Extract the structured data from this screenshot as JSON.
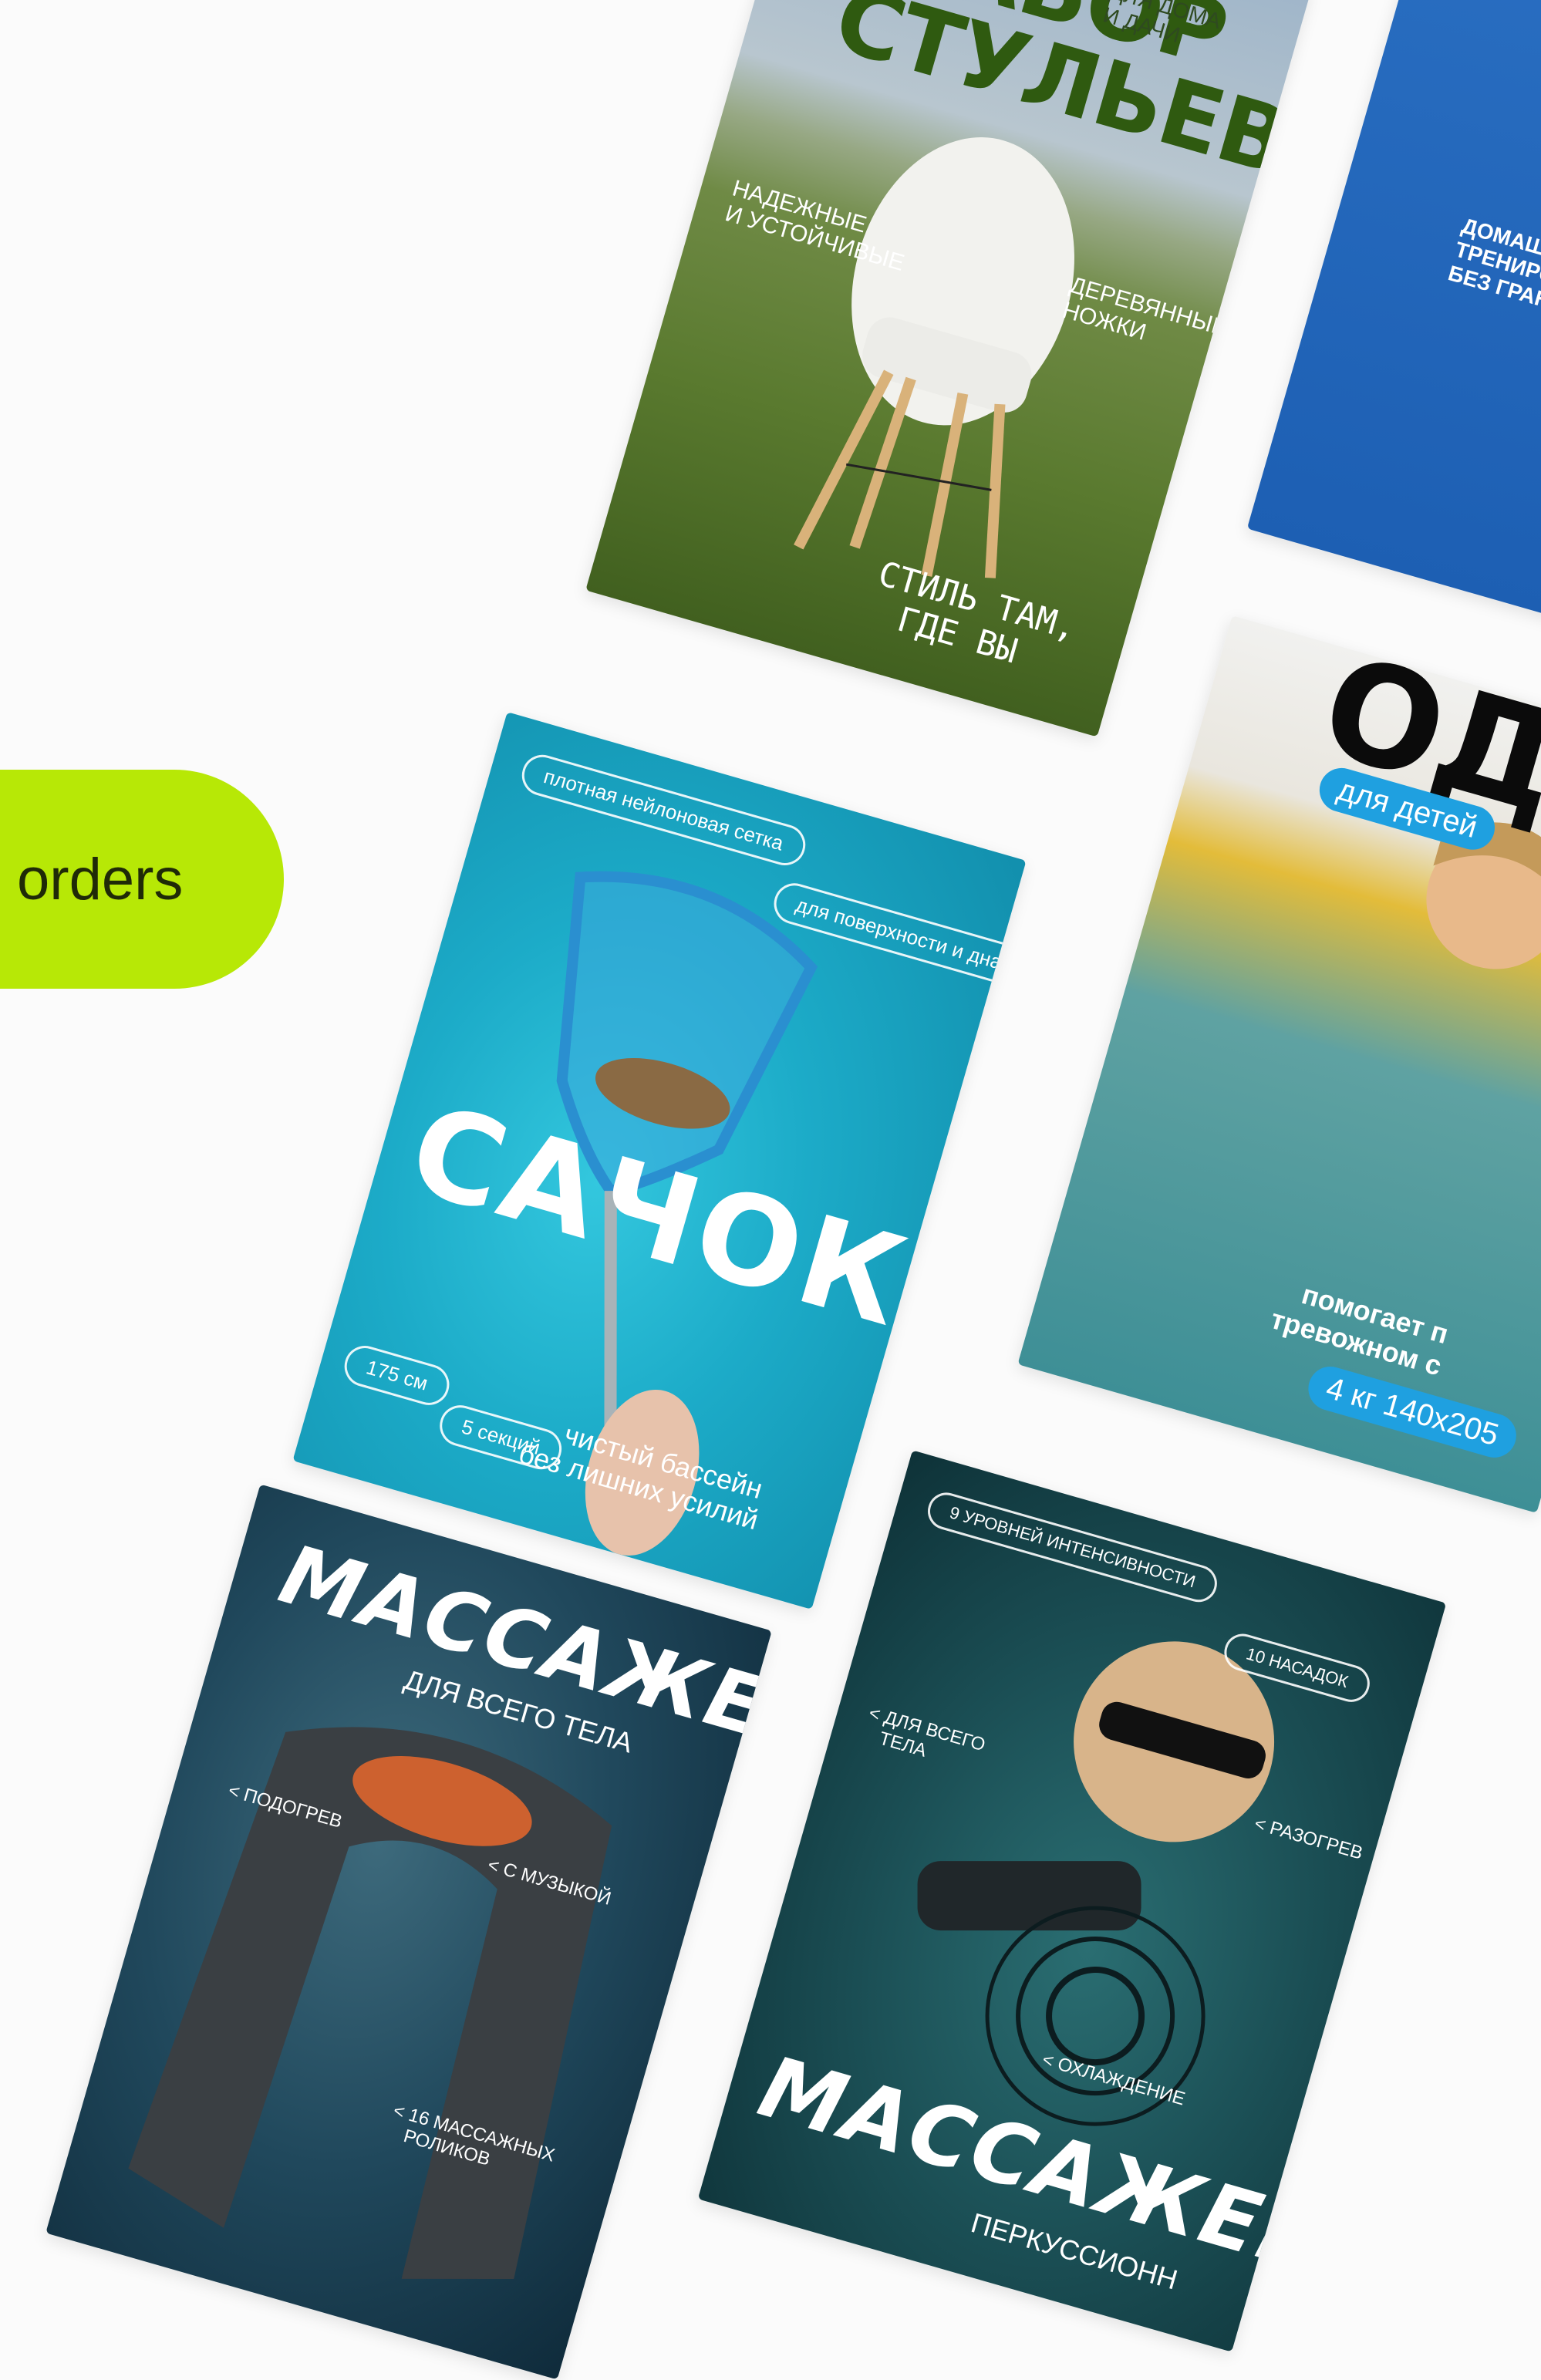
{
  "side_tab": {
    "label": "orders"
  },
  "colors": {
    "accent": "#b7e806"
  },
  "cards": {
    "chairs": {
      "title_line1": "НАБОР",
      "title_line2": "СТУЛЬЕВ",
      "subtitle_line1": "ДЛЯ ДОМА",
      "subtitle_line2": "И ДАЧИ",
      "feature1_line1": "ДЕРЕВЯННЫЕ",
      "feature1_line2": "НОЖКИ",
      "feature2_line1": "НАДЕЖНЫЕ",
      "feature2_line2": "И УСТОЙЧИВЫЕ",
      "slogan_line1": "СТИЛЬ ТАМ,",
      "slogan_line2": "ГДЕ ВЫ"
    },
    "training": {
      "line1": "ДОМАШ",
      "line2": "ТРЕНИРО",
      "line3": "БЕЗ ГРАНИ"
    },
    "net": {
      "pill_mesh": "плотная нейлоновая сетка",
      "pill_surface": "для поверхности и дна",
      "title": "САЧОК",
      "pill_length": "175 см",
      "pill_sections": "5 секций",
      "slogan_line1": "чистый бассейн",
      "slogan_line2": "без лишних усилий"
    },
    "kids": {
      "title": "ОДЕ",
      "badge": "для детей",
      "text_line1": "помогает п",
      "text_line2": "тревожном с",
      "badge_specs": "4 кг 140х205"
    },
    "massager_body": {
      "title": "МАССАЖЕР",
      "subtitle": "ДЛЯ ВСЕГО ТЕЛА",
      "feature_heat": "< ПОДОГРЕВ",
      "feature_music": "< С МУЗЫКОЙ",
      "feature_rollers_line1": "< 16 МАССАЖНЫХ",
      "feature_rollers_line2": "РОЛИКОВ"
    },
    "massager_percussion": {
      "pill_levels": "9 УРОВНЕЙ ИНТЕНСИВНОСТИ",
      "pill_heads": "10 НАСАДОК",
      "feature_body_line1": "< ДЛЯ ВСЕГО",
      "feature_body_line2": "ТЕЛА",
      "feature_heat": "< РАЗОГРЕВ",
      "feature_cool": "< ОХЛАЖДЕНИЕ",
      "title": "МАССАЖЕР",
      "subtitle": "ПЕРКУССИОНН"
    }
  }
}
